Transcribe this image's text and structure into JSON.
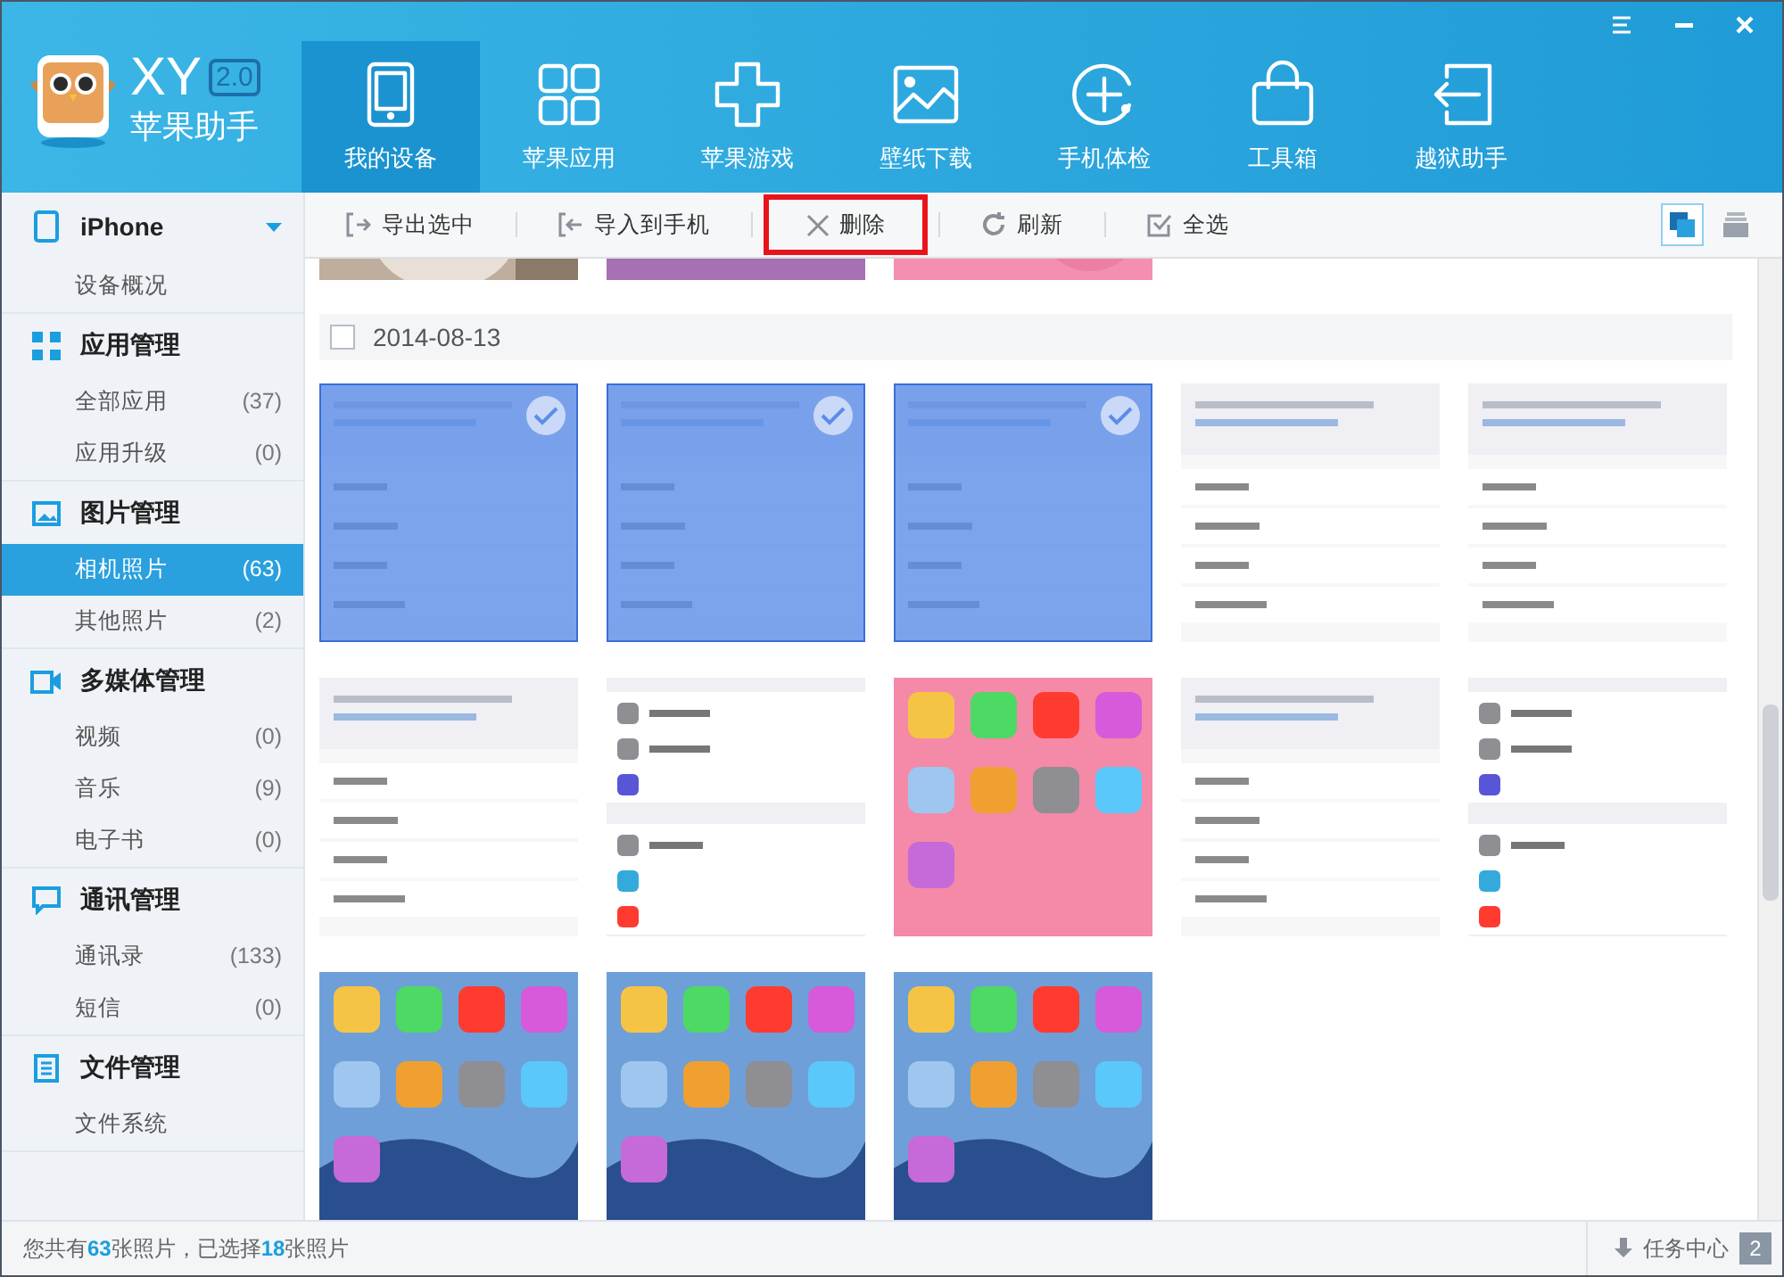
{
  "app": {
    "name": "XY",
    "version": "2.0",
    "subtitle": "苹果助手"
  },
  "nav_tabs": [
    {
      "label": "我的设备",
      "selected": true
    },
    {
      "label": "苹果应用",
      "selected": false
    },
    {
      "label": "苹果游戏",
      "selected": false
    },
    {
      "label": "壁纸下载",
      "selected": false
    },
    {
      "label": "手机体检",
      "selected": false
    },
    {
      "label": "工具箱",
      "selected": false
    },
    {
      "label": "越狱助手",
      "selected": false
    }
  ],
  "sidebar": {
    "sections": [
      {
        "kind": "device",
        "title": "iPhone",
        "items": [
          {
            "label": "设备概况",
            "selected": false
          }
        ]
      },
      {
        "kind": "apps",
        "title": "应用管理",
        "items": [
          {
            "label": "全部应用",
            "count": "(37)",
            "selected": false
          },
          {
            "label": "应用升级",
            "count": "(0)",
            "selected": false
          }
        ]
      },
      {
        "kind": "photos",
        "title": "图片管理",
        "items": [
          {
            "label": "相机照片",
            "count": "(63)",
            "selected": true
          },
          {
            "label": "其他照片",
            "count": "(2)",
            "selected": false
          }
        ]
      },
      {
        "kind": "media",
        "title": "多媒体管理",
        "items": [
          {
            "label": "视频",
            "count": "(0)",
            "selected": false
          },
          {
            "label": "音乐",
            "count": "(9)",
            "selected": false
          },
          {
            "label": "电子书",
            "count": "(0)",
            "selected": false
          }
        ]
      },
      {
        "kind": "contacts",
        "title": "通讯管理",
        "items": [
          {
            "label": "通讯录",
            "count": "(133)",
            "selected": false
          },
          {
            "label": "短信",
            "count": "(0)",
            "selected": false
          }
        ]
      },
      {
        "kind": "files",
        "title": "文件管理",
        "items": [
          {
            "label": "文件系统",
            "selected": false
          }
        ]
      }
    ]
  },
  "toolbar": [
    {
      "kind": "export",
      "label": "导出选中",
      "highlighted": false
    },
    {
      "kind": "import",
      "label": "导入到手机",
      "highlighted": false
    },
    {
      "kind": "delete",
      "label": "删除",
      "highlighted": true
    },
    {
      "kind": "refresh",
      "label": "刷新",
      "highlighted": false
    },
    {
      "kind": "select-all",
      "label": "全选",
      "highlighted": false
    }
  ],
  "view_modes": [
    {
      "kind": "grid",
      "selected": true
    },
    {
      "kind": "stack",
      "selected": false
    }
  ],
  "top_photos": [
    {
      "selected": false
    },
    {
      "selected": false
    },
    {
      "selected": false
    }
  ],
  "date_group": {
    "date": "2014-08-13",
    "checked": false,
    "photos": [
      {
        "selected": true
      },
      {
        "selected": true
      },
      {
        "selected": true
      },
      {
        "selected": false
      },
      {
        "selected": false
      },
      {
        "selected": false
      },
      {
        "selected": false
      },
      {
        "selected": false
      },
      {
        "selected": false
      },
      {
        "selected": false
      },
      {
        "selected": false
      },
      {
        "selected": false
      },
      {
        "selected": false
      }
    ]
  },
  "status_bar": {
    "text": "您共有**63**张照片，已选择**18**张照片",
    "task_center": "任务中心",
    "task_count": "2"
  }
}
